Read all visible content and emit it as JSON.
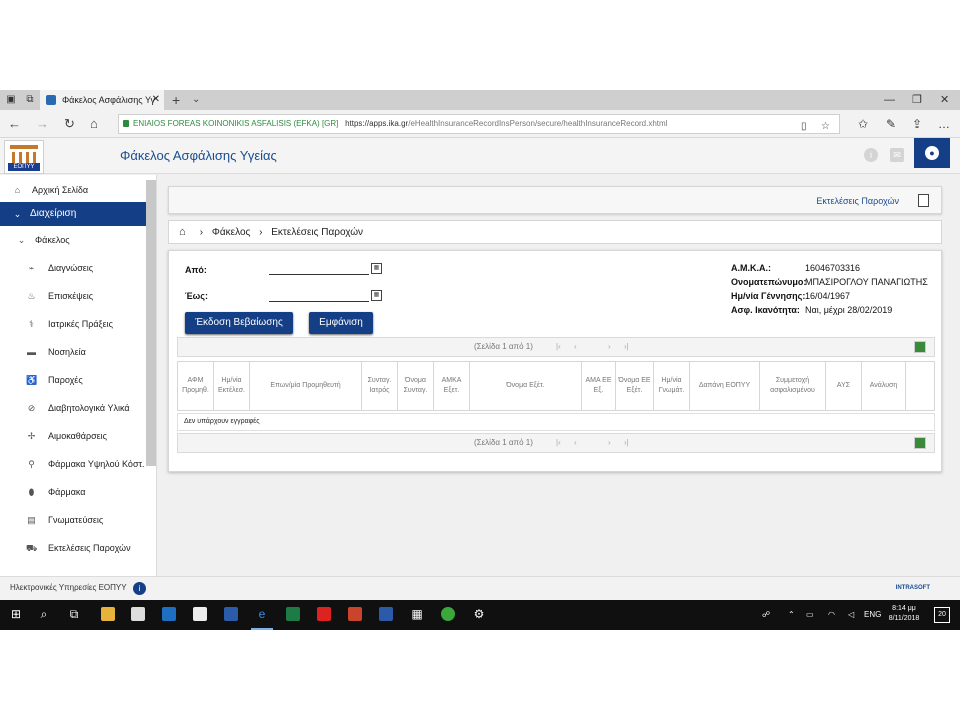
{
  "browser": {
    "tab_title": "Φάκελος Ασφάλισης Υγ",
    "tab_close": "✕",
    "new_tab": "+",
    "tab_menu": "⌄",
    "url_cert": "ENIAIOS FOREAS KOINONIKIS ASFALISIS (EFKA) [GR]",
    "url_host": "https://apps.ika.gr",
    "url_path": "/eHealthInsuranceRecordInsPerson/secure/healthInsuranceRecord.xhtml"
  },
  "header": {
    "logo_text": "ΕΟΠΥΥ",
    "title": "Φάκελος Ασφάλισης Υγείας"
  },
  "sidebar": {
    "home": "Αρχική Σελίδα",
    "admin": "Διαχείριση",
    "folder": "Φάκελος",
    "items": [
      {
        "label": "Διαγνώσεις",
        "icon": "pulse-icon"
      },
      {
        "label": "Επισκέψεις",
        "icon": "visit-icon"
      },
      {
        "label": "Ιατρικές Πράξεις",
        "icon": "medical-act-icon"
      },
      {
        "label": "Νοσηλεία",
        "icon": "bed-icon"
      },
      {
        "label": "Παροχές",
        "icon": "wheelchair-icon"
      },
      {
        "label": "Διαβητολογικά Υλικά",
        "icon": "diabetic-icon"
      },
      {
        "label": "Αιμοκαθάρσεις",
        "icon": "dialysis-icon"
      },
      {
        "label": "Φάρμακα Υψηλού Κόστ.",
        "icon": "high-cost-drug-icon"
      },
      {
        "label": "Φάρμακα",
        "icon": "pills-icon"
      },
      {
        "label": "Γνωματεύσεις",
        "icon": "document-icon"
      },
      {
        "label": "Εκτελέσεις Παροχών",
        "icon": "cart-icon"
      }
    ]
  },
  "main": {
    "top_link": "Εκτελέσεις Παροχών",
    "breadcrumb": [
      "Φάκελος",
      "Εκτελέσεις Παροχών"
    ],
    "from_label": "Από:",
    "to_label": "Έως:",
    "from_value": "",
    "to_value": "",
    "btn_certificate": "Έκδοση Βεβαίωσης",
    "btn_show": "Εμφάνιση",
    "info": [
      {
        "k": "Α.Μ.Κ.Α.:",
        "v": "16046703316"
      },
      {
        "k": "Ονοματεπώνυμο:",
        "v": "ΜΠΑΣΙΡΟΓΛΟΥ ΠΑΝΑΓΙΩΤΗΣ"
      },
      {
        "k": "Ημ/νία Γέννησης:",
        "v": "16/04/1967"
      },
      {
        "k": "Ασφ. Ικανότητα:",
        "v": "Ναι, μέχρι 28/02/2019"
      }
    ],
    "pager_text": "(Σελίδα 1 από 1)",
    "columns": [
      "ΑΦΜ Προμηθ.",
      "Ημ/νία Εκτέλεσ.",
      "Επων/μία Προμηθευτή",
      "Συνταγ. Ιατρός",
      "Όνομα Συνταγ.",
      "ΑΜΚΑ Εξετ.",
      "Όνομα Εξέτ.",
      "ΑΜΑ ΕΕ Εξ.",
      "Όνομα ΕΕ Εξέτ.",
      "Ημ/νία Γνωμάτ.",
      "Δαπάνη ΕΟΠΥΥ",
      "Συμμετοχή ασφαλισμένου",
      "ΑΥΣ",
      "Ανάλυση"
    ],
    "empty_text": "Δεν υπάρχουν εγγραφές"
  },
  "footer": {
    "text": "Ηλεκτρονικές Υπηρεσίες ΕΟΠΥΥ",
    "brand": "INTRASOFT"
  },
  "taskbar": {
    "time": "8:14 μμ",
    "date": "8/11/2018",
    "lang": "ENG",
    "notifications": "20"
  }
}
